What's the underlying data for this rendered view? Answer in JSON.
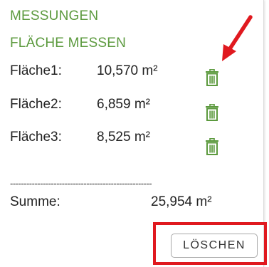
{
  "panel": {
    "title": "MESSUNGEN",
    "subtitle": "FLÄCHE MESSEN"
  },
  "measurements": [
    {
      "label": "Fläche1:",
      "value": "10,570 m²",
      "delete_icon": "trash-icon"
    },
    {
      "label": "Fläche2:",
      "value": "6,859 m²",
      "delete_icon": "trash-icon"
    },
    {
      "label": "Fläche3:",
      "value": "8,525 m²",
      "delete_icon": "trash-icon"
    }
  ],
  "divider": "----------------------------------------------------",
  "sum": {
    "label": "Summe:",
    "value": "25,954 m²"
  },
  "actions": {
    "clear_label": "LÖSCHEN"
  },
  "colors": {
    "accent_green": "#5c9a3e",
    "annotation_red": "#e0191f"
  }
}
